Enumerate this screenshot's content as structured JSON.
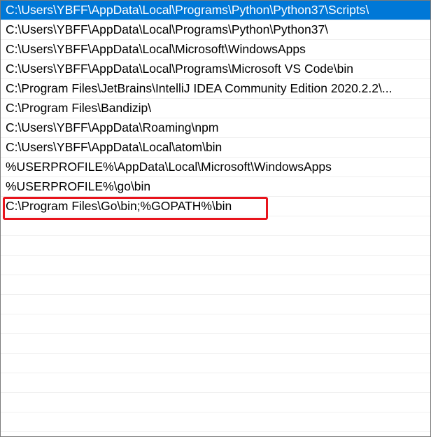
{
  "path_list": {
    "entries": [
      {
        "text": "C:\\Users\\YBFF\\AppData\\Local\\Programs\\Python\\Python37\\Scripts\\",
        "selected": true
      },
      {
        "text": "C:\\Users\\YBFF\\AppData\\Local\\Programs\\Python\\Python37\\",
        "selected": false
      },
      {
        "text": "C:\\Users\\YBFF\\AppData\\Local\\Microsoft\\WindowsApps",
        "selected": false
      },
      {
        "text": "C:\\Users\\YBFF\\AppData\\Local\\Programs\\Microsoft VS Code\\bin",
        "selected": false
      },
      {
        "text": "C:\\Program Files\\JetBrains\\IntelliJ IDEA Community Edition 2020.2.2\\...",
        "selected": false
      },
      {
        "text": "C:\\Program Files\\Bandizip\\",
        "selected": false
      },
      {
        "text": "C:\\Users\\YBFF\\AppData\\Roaming\\npm",
        "selected": false
      },
      {
        "text": "C:\\Users\\YBFF\\AppData\\Local\\atom\\bin",
        "selected": false
      },
      {
        "text": "%USERPROFILE%\\AppData\\Local\\Microsoft\\WindowsApps",
        "selected": false
      },
      {
        "text": "%USERPROFILE%\\go\\bin",
        "selected": false
      },
      {
        "text": "C:\\Program Files\\Go\\bin;%GOPATH%\\bin",
        "selected": false
      }
    ],
    "highlighted_entry_index": 10
  },
  "colors": {
    "selection_background": "#0078d7",
    "selection_text": "#ffffff",
    "highlight_border": "#e8141c",
    "row_divider": "#f0f0f0"
  }
}
